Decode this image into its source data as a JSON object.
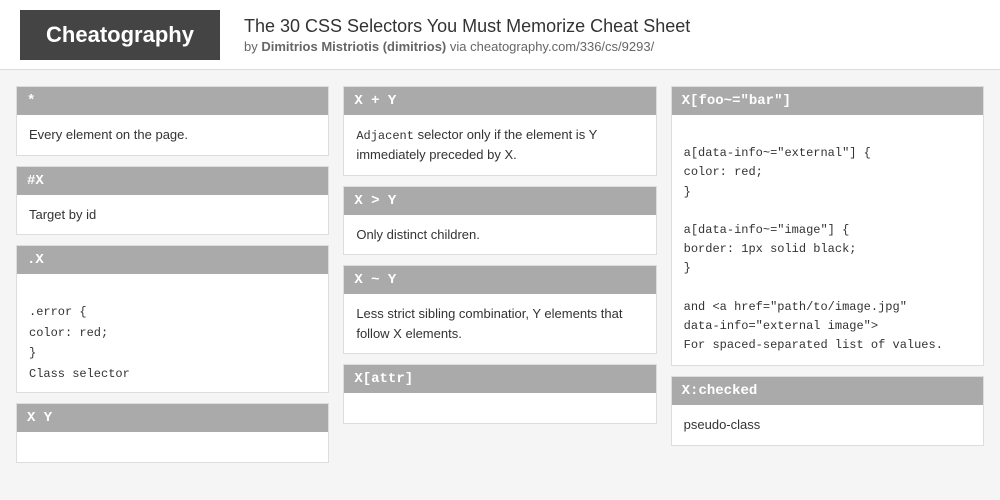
{
  "header": {
    "logo": "Cheatography",
    "title": "The 30 CSS Selectors You Must Memorize Cheat Sheet",
    "subtitle_by": "by",
    "author": "Dimitrios Mistriotis (dimitrios)",
    "via": "via",
    "url": "cheatography.com/336/cs/9293/"
  },
  "col1": {
    "cards": [
      {
        "id": "card-star",
        "header": "*",
        "body": "Every element on the page."
      },
      {
        "id": "card-hashx",
        "header": "#X",
        "body": "Target by id"
      },
      {
        "id": "card-dotx",
        "header": ".X",
        "code": ".error {\ncolor: red;\n}\nClass selector"
      },
      {
        "id": "card-xy",
        "header": "X Y",
        "body": ""
      }
    ]
  },
  "col2": {
    "cards": [
      {
        "id": "card-xplusy",
        "header": "X + Y",
        "body": "Adjacent selector only if the element is Y immediately preceded by X."
      },
      {
        "id": "card-xgty",
        "header": "X > Y",
        "body": "Only distinct children."
      },
      {
        "id": "card-xtildey",
        "header": "X ~ Y",
        "body": "Less strict sibling combinatior, Y elements that follow X elements."
      },
      {
        "id": "card-xattr",
        "header": "X[attr]",
        "body": ""
      }
    ]
  },
  "col3": {
    "cards": [
      {
        "id": "card-xfoobar",
        "header": "X[foo~=\"bar\"]",
        "code": "a[data-info~=\"external\"] {\ncolor: red;\n}\n\na[data-info~=\"image\"] {\nborder: 1px solid black;\n}\n\nand <a href=\"path/to/image.jpg\"\ndata-info=\"external image\">\nFor spaced-separated list of values."
      },
      {
        "id": "card-xchecked",
        "header": "X:checked",
        "body": "pseudo-class"
      }
    ]
  }
}
